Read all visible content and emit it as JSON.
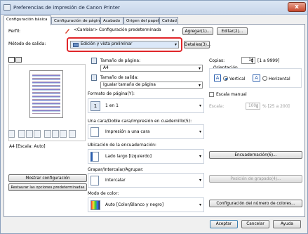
{
  "window": {
    "title": "Preferencias de impresión de Canon Printer",
    "close": "x"
  },
  "tabs": [
    "Configuración básica",
    "Configuración de página",
    "Acabado",
    "Origen del papel",
    "Calidad"
  ],
  "profile": {
    "label": "Perfil:",
    "value": "<Cambiar> Configuración predeterminada",
    "add": "Agregar(1)...",
    "edit": "Editar(2)..."
  },
  "output": {
    "label": "Método de salida:",
    "value": "Edición y vista preliminar",
    "details": "Detalles(3)..."
  },
  "preview": {
    "caption": "A4 [Escala: Auto]",
    "show_btn": "Mostrar configuración",
    "restore_btn": "Restaurar las opciones predeterminadas"
  },
  "page_size": {
    "label": "Tamaño de página:",
    "value": "A4"
  },
  "output_size": {
    "label": "Tamaño de salida:",
    "value": "Igualar tamaño de página"
  },
  "copies": {
    "label": "Copias:",
    "value": "1",
    "range": "[1 a 9999]"
  },
  "orientation": {
    "label": "Orientación",
    "vertical": "Vertical",
    "horizontal": "Horizontal"
  },
  "page_layout": {
    "label": "Formato de página(Y):",
    "value": "1 en 1",
    "icon_num": "1"
  },
  "manual_scale": {
    "label": "Escala manual",
    "scale_label": "Escala:",
    "scale_value": "100",
    "scale_range": "% [25 a 200]"
  },
  "duplex": {
    "label": "Una cara/Doble cara/Impresión en cuadernillo(5):",
    "value": "Impresión a una cara"
  },
  "binding": {
    "label": "Ubicación de la encuadernación:",
    "value": "Lado largo [Izquierdo]",
    "button": "Encuadernación(6)..."
  },
  "finishing": {
    "label": "Grapar/Intercalar/Agrupar:",
    "value": "Intercalar",
    "button": "Posición de grapado(4)..."
  },
  "color": {
    "label": "Modo de color:",
    "value": "Auto [Color/Blanco y negro]",
    "button": "Configuración del número de colores..."
  },
  "footer": {
    "ok": "Aceptar",
    "cancel": "Cancelar",
    "help": "Ayuda"
  }
}
